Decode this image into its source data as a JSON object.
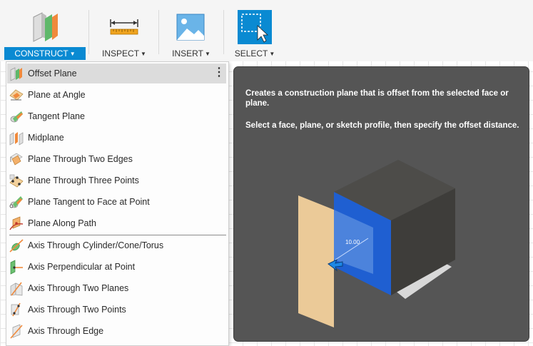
{
  "toolbar": {
    "groups": [
      {
        "label": "CONSTRUCT",
        "icon": "construct-planes-icon",
        "active": true
      },
      {
        "label": "INSPECT",
        "icon": "measure-ruler-icon",
        "active": false
      },
      {
        "label": "INSERT",
        "icon": "insert-image-icon",
        "active": false
      },
      {
        "label": "SELECT",
        "icon": "select-window-icon",
        "active": false
      }
    ]
  },
  "menu": {
    "more_glyph": "⋮",
    "items": [
      {
        "label": "Offset Plane",
        "icon": "offset-plane-icon"
      },
      {
        "label": "Plane at Angle",
        "icon": "plane-at-angle-icon"
      },
      {
        "label": "Tangent Plane",
        "icon": "tangent-plane-icon"
      },
      {
        "label": "Midplane",
        "icon": "midplane-icon"
      },
      {
        "label": "Plane Through Two Edges",
        "icon": "plane-two-edges-icon"
      },
      {
        "label": "Plane Through Three Points",
        "icon": "plane-three-points-icon"
      },
      {
        "label": "Plane Tangent to Face at Point",
        "icon": "plane-tangent-face-point-icon"
      },
      {
        "label": "Plane Along Path",
        "icon": "plane-along-path-icon"
      },
      {
        "label": "Axis Through Cylinder/Cone/Torus",
        "icon": "axis-cylinder-icon"
      },
      {
        "label": "Axis Perpendicular at Point",
        "icon": "axis-perpendicular-point-icon"
      },
      {
        "label": "Axis Through Two Planes",
        "icon": "axis-two-planes-icon"
      },
      {
        "label": "Axis Through Two Points",
        "icon": "axis-two-points-icon"
      },
      {
        "label": "Axis Through Edge",
        "icon": "axis-edge-icon"
      }
    ]
  },
  "tooltip": {
    "line1": "Creates a construction plane that is offset from the selected face or plane.",
    "line2": "Select a face, plane, or sketch profile, then specify the offset distance.",
    "dimension_value": "10.00"
  },
  "colors": {
    "accent": "#0a8ad2",
    "tooltip_bg": "#555555",
    "cube_face_blue": "#1f5fd1",
    "offset_plane": "#f3d19c"
  }
}
